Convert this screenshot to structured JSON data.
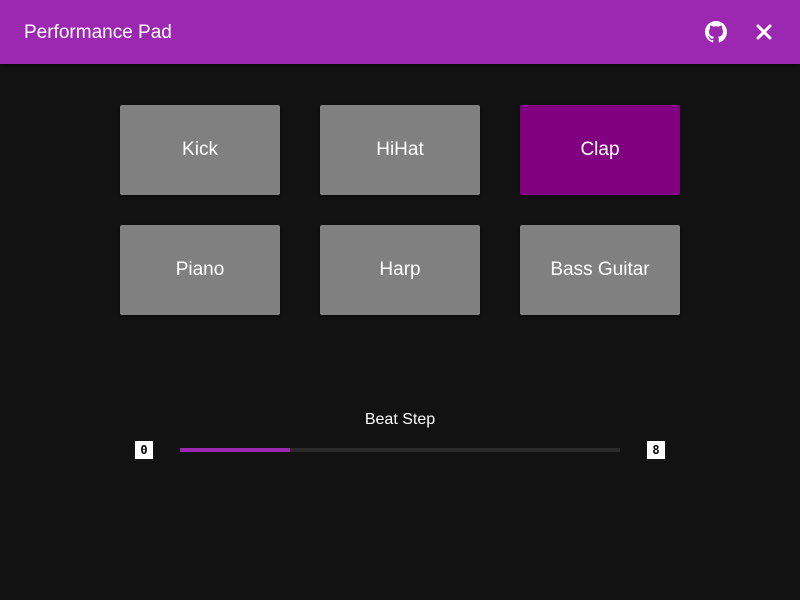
{
  "app": {
    "title": "Performance Pad",
    "accent_color": "#9c27b0",
    "icons": {
      "github": "github-icon",
      "close": "close-icon"
    }
  },
  "pads": [
    {
      "label": "Kick",
      "active": false
    },
    {
      "label": "HiHat",
      "active": false
    },
    {
      "label": "Clap",
      "active": true
    },
    {
      "label": "Piano",
      "active": false
    },
    {
      "label": "Harp",
      "active": false
    },
    {
      "label": "Bass Guitar",
      "active": false
    }
  ],
  "pad_colors": {
    "default": "#808080",
    "active": "#800080"
  },
  "beat_step": {
    "label": "Beat Step",
    "min": "0",
    "max": "8",
    "value": 2
  }
}
